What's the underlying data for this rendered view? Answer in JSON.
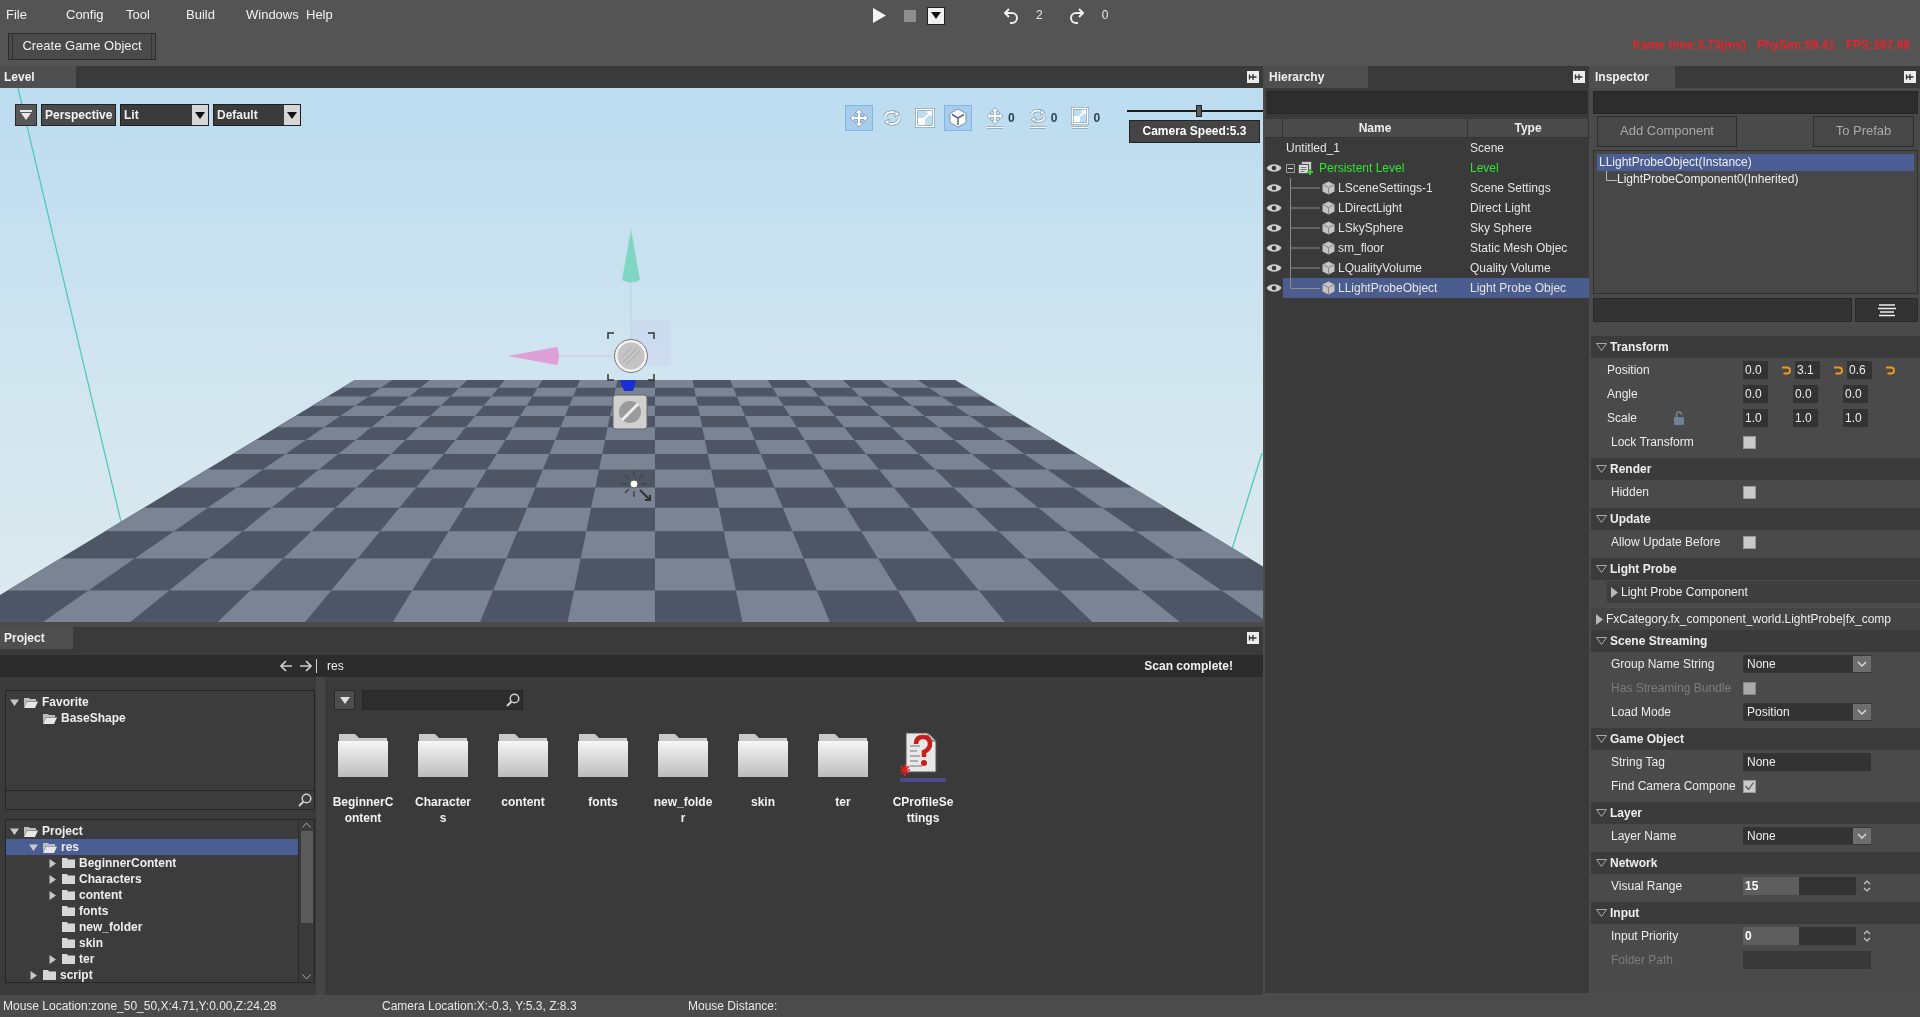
{
  "menu": [
    "File",
    "Config",
    "Tool",
    "Build",
    "Windows",
    "Help"
  ],
  "playback": {
    "undo_count": "2",
    "redo_count": "0"
  },
  "toolbar": {
    "buttons": [
      "Create Game Object"
    ]
  },
  "stats": [
    "frame time:3.73(ms)",
    "PhySim:59.41",
    "FPS:267.98"
  ],
  "level": {
    "title": "Level",
    "view": "Perspective",
    "shading": "Lit",
    "preset": "Default",
    "tools": [
      {
        "kind": "move",
        "selected": true
      },
      {
        "kind": "rotate",
        "selected": false
      },
      {
        "kind": "scale",
        "selected": false
      },
      {
        "kind": "space",
        "selected": true
      }
    ],
    "snaps": [
      {
        "kind": "move",
        "count": "0"
      },
      {
        "kind": "rotate",
        "count": "0"
      },
      {
        "kind": "scale",
        "count": "0"
      }
    ],
    "camera_speed": {
      "level": 0.53,
      "label": "Camera Speed:5.3"
    }
  },
  "hierarchy": {
    "title": "Hierarchy",
    "columns": [
      "Name",
      "Type"
    ],
    "rows": [
      {
        "name": "Untitled_1",
        "type": "Scene",
        "kind": "scene",
        "selected": false
      },
      {
        "name": "Persistent Level",
        "type": "Level",
        "kind": "level",
        "selected": false,
        "expanded": true,
        "children": [
          {
            "name": "LSceneSettings-1",
            "type": "Scene Settings",
            "kind": "object",
            "selected": false
          },
          {
            "name": "LDirectLight",
            "type": "Direct Light",
            "kind": "object",
            "selected": false
          },
          {
            "name": "LSkySphere",
            "type": "Sky Sphere",
            "kind": "object",
            "selected": false
          },
          {
            "name": "sm_floor",
            "type": "Static Mesh Objec",
            "kind": "object",
            "selected": false
          },
          {
            "name": "LQualityVolume",
            "type": "Quality Volume",
            "kind": "object",
            "selected": false
          },
          {
            "name": "LLightProbeObject",
            "type": "Light Probe Objec",
            "kind": "object",
            "selected": true
          }
        ]
      }
    ]
  },
  "inspector": {
    "title": "Inspector",
    "buttons": [
      "Add Component",
      "To Prefab"
    ],
    "components": [
      {
        "name": "LLightProbeObject(Instance)",
        "selected": true,
        "children": [
          {
            "name": "LightProbeComponent0(Inherited)",
            "selected": false
          }
        ]
      }
    ],
    "sections": [
      {
        "title": "Transform",
        "expanded": true,
        "rows": [
          {
            "kind": "vector",
            "label": "Position",
            "values": [
              "0.0",
              "3.1",
              "0.6"
            ],
            "modified": true,
            "disabled": false
          },
          {
            "kind": "vector",
            "label": "Angle",
            "values": [
              "0.0",
              "0.0",
              "0.0"
            ],
            "modified": false,
            "disabled": false
          },
          {
            "kind": "vector",
            "label": "Scale",
            "values": [
              "1.0",
              "1.0",
              "1.0"
            ],
            "modified": false,
            "ratio_locked": false,
            "disabled": false
          },
          {
            "kind": "checkbox",
            "label": "Lock Transform",
            "checked": false,
            "disabled": false
          }
        ]
      },
      {
        "title": "Render",
        "expanded": true,
        "rows": [
          {
            "kind": "checkbox",
            "label": "Hidden",
            "checked": false,
            "disabled": false
          }
        ]
      },
      {
        "title": "Update",
        "expanded": true,
        "rows": [
          {
            "kind": "checkbox",
            "label": "Allow Update Before",
            "checked": false,
            "disabled": false
          }
        ]
      },
      {
        "title": "Light Probe",
        "expanded": true,
        "rows": [
          {
            "kind": "group",
            "label": "Light Probe Component",
            "expanded": false,
            "disabled": false
          }
        ]
      },
      {
        "title": "FxCategory.fx_component_world.LightProbe|fx_comp",
        "expanded": false
      },
      {
        "title": "Scene Streaming",
        "expanded": true,
        "rows": [
          {
            "kind": "dropdown",
            "label": "Group Name String",
            "value": "None",
            "disabled": false
          },
          {
            "kind": "checkbox",
            "label": "Has Streaming Bundle",
            "checked": false,
            "disabled": true
          },
          {
            "kind": "dropdown",
            "label": "Load Mode",
            "value": "Position",
            "disabled": false
          }
        ]
      },
      {
        "title": "Game Object",
        "expanded": true,
        "rows": [
          {
            "kind": "text",
            "label": "String Tag",
            "value": "None",
            "disabled": false
          },
          {
            "kind": "checkbox",
            "label": "Find Camera Compone",
            "checked": true,
            "disabled": false
          }
        ]
      },
      {
        "title": "Layer",
        "expanded": true,
        "rows": [
          {
            "kind": "dropdown",
            "label": "Layer Name",
            "value": "None",
            "disabled": false
          }
        ]
      },
      {
        "title": "Network",
        "expanded": true,
        "rows": [
          {
            "kind": "spinner",
            "label": "Visual Range",
            "value": "15",
            "disabled": false
          }
        ]
      },
      {
        "title": "Input",
        "expanded": true,
        "rows": [
          {
            "kind": "spinner",
            "label": "Input Priority",
            "value": "0",
            "disabled": false
          },
          {
            "kind": "text",
            "label": "Folder Path",
            "disabled": true
          }
        ]
      }
    ]
  },
  "project": {
    "title": "Project",
    "path": "res",
    "status": "Scan complete!",
    "favorites": [
      {
        "name": "Favorite",
        "expanded": true,
        "selected": false,
        "children": [
          {
            "name": "BaseShape",
            "selected": false
          }
        ]
      }
    ],
    "tree": [
      {
        "name": "Project",
        "expanded": true,
        "selected": false,
        "children": [
          {
            "name": "res",
            "expanded": true,
            "selected": true,
            "children": [
              {
                "name": "BeginnerContent",
                "expanded": false,
                "selected": false
              },
              {
                "name": "Characters",
                "expanded": false,
                "selected": false
              },
              {
                "name": "content",
                "expanded": false,
                "selected": false
              },
              {
                "name": "fonts",
                "selected": false
              },
              {
                "name": "new_folder",
                "selected": false
              },
              {
                "name": "skin",
                "selected": false
              },
              {
                "name": "ter",
                "expanded": false,
                "selected": false
              }
            ]
          },
          {
            "name": "script",
            "expanded": false,
            "selected": false
          }
        ]
      }
    ],
    "files": [
      {
        "name": "BeginnerContent",
        "kind": "folder",
        "selected": false
      },
      {
        "name": "Characters",
        "kind": "folder",
        "selected": false
      },
      {
        "name": "content",
        "kind": "folder",
        "selected": false
      },
      {
        "name": "fonts",
        "kind": "folder",
        "selected": false
      },
      {
        "name": "new_folder",
        "kind": "folder",
        "selected": false
      },
      {
        "name": "skin",
        "kind": "folder",
        "selected": false
      },
      {
        "name": "ter",
        "kind": "folder",
        "selected": false
      },
      {
        "name": "CProfileSettings",
        "kind": "settings",
        "selected": false
      }
    ]
  },
  "status_bar": [
    "Mouse Location:zone_50_50,X:4.71,Y:0.00,Z:24.28",
    "Camera Location:X:-0.3, Y:5.3, Z:8.3",
    "Mouse Distance:"
  ]
}
